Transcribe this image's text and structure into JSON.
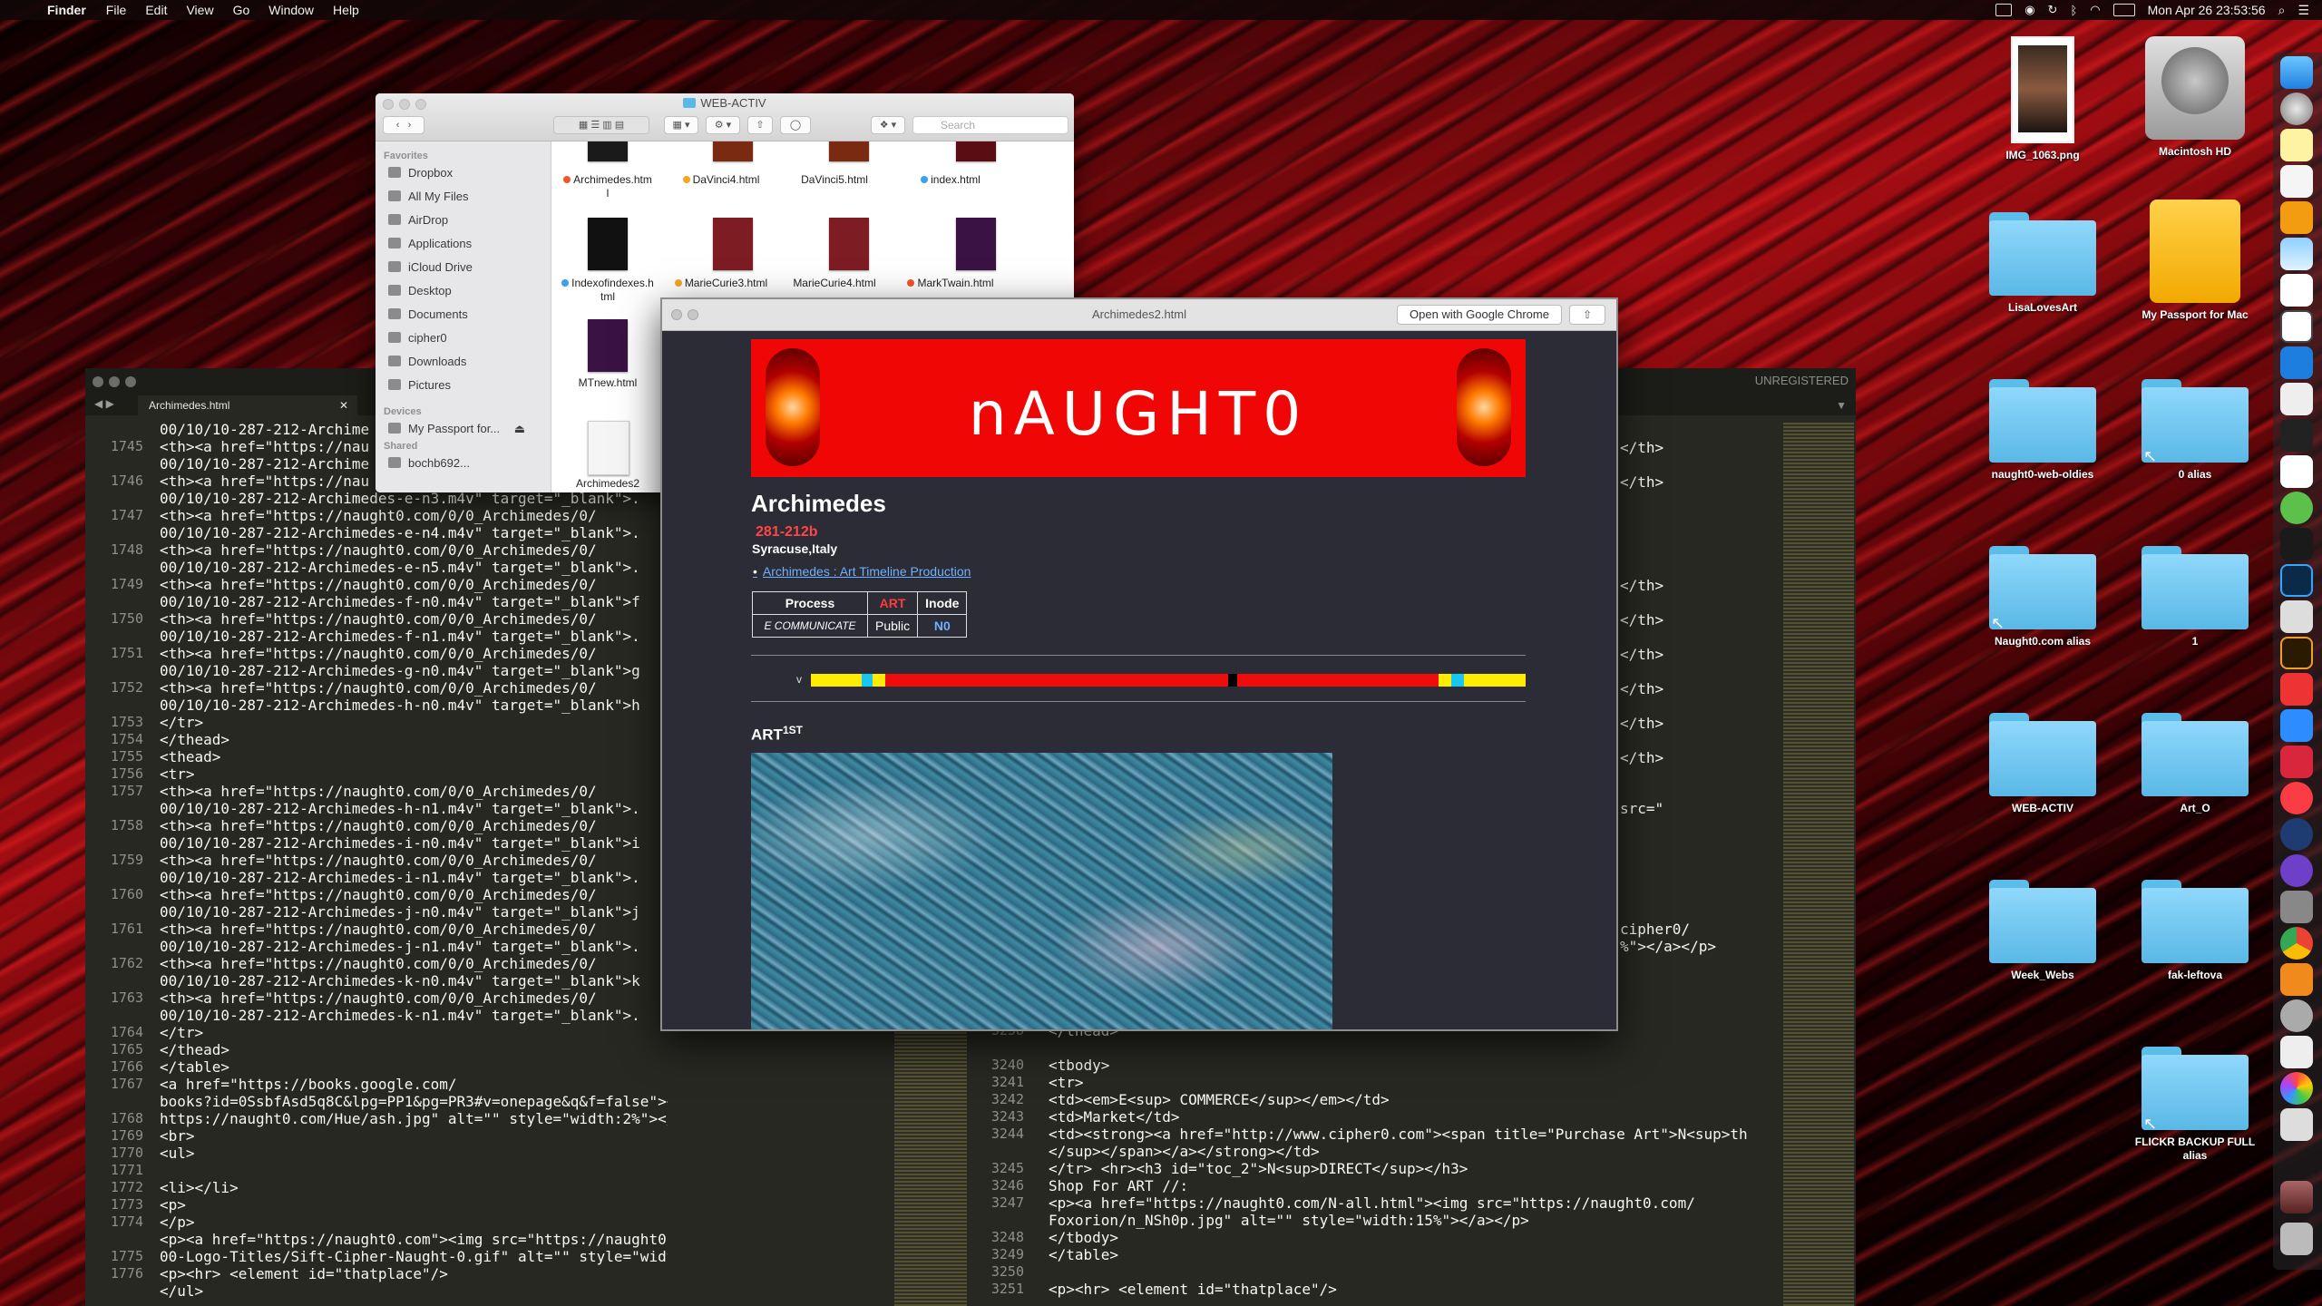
{
  "menubar": {
    "app": "Finder",
    "items": [
      "File",
      "Edit",
      "View",
      "Go",
      "Window",
      "Help"
    ],
    "clock": "Mon Apr 26  23:53:56"
  },
  "editor": {
    "tab": "Archimedes.html",
    "unregistered": "UNREGISTERED",
    "left_gutter": "\n1745\n\n1746\n\n1747\n\n1748\n\n1749\n\n1750\n\n1751\n\n1752\n\n1753\n1754\n1755\n1756\n1757\n\n1758\n\n1759\n\n1760\n\n1761\n\n1762\n\n1763\n\n1764\n1765\n1766\n1767\n\n1768\n1769\n1770\n1771\n1772\n1773\n1774\n\n1775\n1776",
    "left_code": "00/10/10-287-212-Archime\n<th><a href=\"https://nau\n00/10/10-287-212-Archime\n<th><a href=\"https://nau\n00/10/10-287-212-Archimedes-e-n3.m4v\" target=\"_blank\">.\n<th><a href=\"https://naught0.com/0/0_Archimedes/0/\n00/10/10-287-212-Archimedes-e-n4.m4v\" target=\"_blank\">.\n<th><a href=\"https://naught0.com/0/0_Archimedes/0/\n00/10/10-287-212-Archimedes-e-n5.m4v\" target=\"_blank\">.\n<th><a href=\"https://naught0.com/0/0_Archimedes/0/\n00/10/10-287-212-Archimedes-f-n0.m4v\" target=\"_blank\">f\n<th><a href=\"https://naught0.com/0/0_Archimedes/0/\n00/10/10-287-212-Archimedes-f-n1.m4v\" target=\"_blank\">.\n<th><a href=\"https://naught0.com/0/0_Archimedes/0/\n00/10/10-287-212-Archimedes-g-n0.m4v\" target=\"_blank\">g\n<th><a href=\"https://naught0.com/0/0_Archimedes/0/\n00/10/10-287-212-Archimedes-h-n0.m4v\" target=\"_blank\">h\n</tr>\n</thead>\n<thead>\n<tr>\n<th><a href=\"https://naught0.com/0/0_Archimedes/0/\n00/10/10-287-212-Archimedes-h-n1.m4v\" target=\"_blank\">.\n<th><a href=\"https://naught0.com/0/0_Archimedes/0/\n00/10/10-287-212-Archimedes-i-n0.m4v\" target=\"_blank\">i\n<th><a href=\"https://naught0.com/0/0_Archimedes/0/\n00/10/10-287-212-Archimedes-i-n1.m4v\" target=\"_blank\">.\n<th><a href=\"https://naught0.com/0/0_Archimedes/0/\n00/10/10-287-212-Archimedes-j-n0.m4v\" target=\"_blank\">j\n<th><a href=\"https://naught0.com/0/0_Archimedes/0/\n00/10/10-287-212-Archimedes-j-n1.m4v\" target=\"_blank\">.\n<th><a href=\"https://naught0.com/0/0_Archimedes/0/\n00/10/10-287-212-Archimedes-k-n0.m4v\" target=\"_blank\">k\n<th><a href=\"https://naught0.com/0/0_Archimedes/0/\n00/10/10-287-212-Archimedes-k-n1.m4v\" target=\"_blank\">.\n</tr>\n</thead>\n</table>\n<a href=\"https://books.google.com/\nbooks?id=0SsbfAsd5q8C&lpg=PP1&pg=PR3#v=onepage&q&f=false\"><img src=\"\nhttps://naught0.com/Hue/ash.jpg\" alt=\"\" style=\"width:2%\"></a>\n<br>\n<ul>\n\n<li></li>\n<p>\n</p>\n<p><a href=\"https://naught0.com\"><img src=\"https://naught0.com/cipher0/\n00-Logo-Titles/Sift-Cipher-Naught-0.gif\" alt=\"\" style=\"width:12%\"></a></p>\n<p><hr> <element id=\"thatplace\"/>\n</ul>",
    "right_tags": "</th>\n\n</th>\n\n\n\n\n\n</th>\n\n</th>\n\n</th>\n\n</th>\n\n</th>\n\n</th>",
    "right_mid": "src=\"\n\n\n\n\n\n\ncipher0/\n%\"></a></p>",
    "right_gutter": "3238\n\n3240\n3241\n3242\n3243\n3244\n\n3245\n3246\n3247\n\n3248\n3249\n3250\n3251",
    "right_code": "</thead>\n\n<tbody>\n<tr>\n<td><em>E<sup> COMMERCE</sup></em></td>\n<td>Market</td>\n<td><strong><a href=\"http://www.cipher0.com\"><span title=\"Purchase Art\">N<sup>th\n</sup></span></a></strong></td>\n</tr> <hr><h3 id=\"toc_2\">N<sup>DIRECT</sup></h3>\nShop For ART //:\n<p><a href=\"https://naught0.com/N-all.html\"><img src=\"https://naught0.com/\nFoxorion/n_NSh0p.jpg\" alt=\"\" style=\"width:15%\"></a></p>\n</tbody>\n</table>\n\n<p><hr> <element id=\"thatplace\"/>"
  },
  "finder": {
    "title": "WEB-ACTIV",
    "search_placeholder": "Search",
    "sidebar": {
      "favorites_label": "Favorites",
      "favorites": [
        "Dropbox",
        "All My Files",
        "AirDrop",
        "Applications",
        "iCloud Drive",
        "Desktop",
        "Documents",
        "cipher0",
        "Downloads",
        "Pictures"
      ],
      "devices_label": "Devices",
      "devices": [
        "My Passport for..."
      ],
      "shared_label": "Shared",
      "shared": [
        "bochb692..."
      ]
    },
    "files": [
      {
        "name": "Archimedes.htm\nl",
        "tag": "#f0572a"
      },
      {
        "name": "DaVinci4.html",
        "tag": "#f5a623"
      },
      {
        "name": "DaVinci5.html",
        "tag": ""
      },
      {
        "name": "index.html",
        "tag": "#3aa0f0"
      },
      {
        "name": "Indexofindexes.h\ntml",
        "tag": "#3aa0f0"
      },
      {
        "name": "MarieCurie3.html",
        "tag": "#f5a623"
      },
      {
        "name": "MarieCurie4.html",
        "tag": ""
      },
      {
        "name": "MarkTwain.html",
        "tag": "#f0572a"
      },
      {
        "name": "MTnew.html",
        "tag": ""
      },
      {
        "name": "Archimedes2",
        "tag": ""
      }
    ]
  },
  "quicklook": {
    "title": "Archimedes2.html",
    "open_button": "Open with Google Chrome",
    "banner_logo": "nAUGHT0",
    "heading": "Archimedes",
    "dates": "281-212b",
    "place": "Syracuse,Italy",
    "link": "Archimedes : Art Timeline Production",
    "table": [
      [
        "Process",
        "ART",
        "Inode"
      ],
      [
        "E COMMUNICATE",
        "Public",
        "N0"
      ]
    ],
    "v_marker": "v",
    "art_heading": "ART",
    "art_sup": "1ST"
  },
  "desktop_icons": [
    {
      "label": "IMG_1063.png"
    },
    {
      "label": "Macintosh HD"
    },
    {
      "label": "LisaLovesArt"
    },
    {
      "label": "My Passport for Mac"
    },
    {
      "label": "naught0-web-oldies"
    },
    {
      "label": "0 alias"
    },
    {
      "label": "Naught0.com alias"
    },
    {
      "label": "1"
    },
    {
      "label": "WEB-ACTIV"
    },
    {
      "label": "Art_O"
    },
    {
      "label": "Week_Webs"
    },
    {
      "label": "fak-leftova"
    },
    {
      "label": "FLICKR BACKUP FULL\nalias"
    }
  ]
}
